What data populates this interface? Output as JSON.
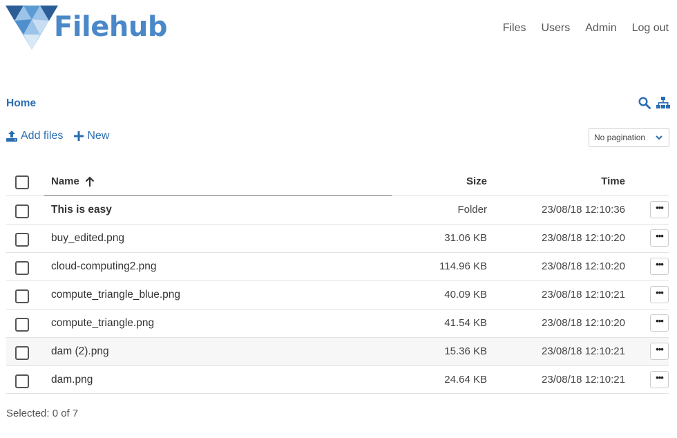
{
  "app": {
    "name": "Filehub",
    "brand_color": "#4a88c7",
    "link_color": "#2a6db0"
  },
  "nav": {
    "items": [
      "Files",
      "Users",
      "Admin",
      "Log out"
    ]
  },
  "breadcrumb": {
    "current": "Home"
  },
  "toolbar": {
    "icons": [
      "search-icon",
      "sitemap-icon"
    ],
    "add_files_label": "Add files",
    "new_label": "New",
    "pagination_value": "No pagination"
  },
  "table": {
    "headers": {
      "name": "Name",
      "size": "Size",
      "time": "Time"
    },
    "sort": {
      "column": "Name",
      "direction": "ascending"
    },
    "rows": [
      {
        "name": "This is easy",
        "size": "Folder",
        "time": "23/08/18 12:10:36",
        "is_folder": true
      },
      {
        "name": "buy_edited.png",
        "size": "31.06 KB",
        "time": "23/08/18 12:10:20"
      },
      {
        "name": "cloud-computing2.png",
        "size": "114.96 KB",
        "time": "23/08/18 12:10:20"
      },
      {
        "name": "compute_triangle_blue.png",
        "size": "40.09 KB",
        "time": "23/08/18 12:10:21"
      },
      {
        "name": "compute_triangle.png",
        "size": "41.54 KB",
        "time": "23/08/18 12:10:20"
      },
      {
        "name": "dam (2).png",
        "size": "15.36 KB",
        "time": "23/08/18 12:10:21"
      },
      {
        "name": "dam.png",
        "size": "24.64 KB",
        "time": "23/08/18 12:10:21"
      }
    ],
    "row_action_label": "•••"
  },
  "footer": {
    "selected_text": "Selected: 0 of 7"
  }
}
